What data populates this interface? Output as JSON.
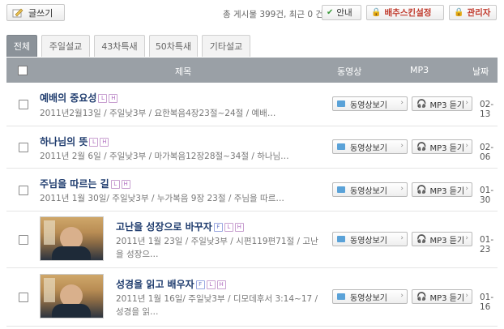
{
  "toolbar": {
    "write_label": "글쓰기",
    "count_text": "총 게시물 399건, 최근 0 건",
    "guide_label": "안내",
    "skin_label": "배추스킨설정",
    "admin_label": "관리자"
  },
  "tabs": [
    {
      "label": "전체",
      "active": true
    },
    {
      "label": "주일설교",
      "active": false
    },
    {
      "label": "43차특새",
      "active": false
    },
    {
      "label": "50차특새",
      "active": false
    },
    {
      "label": "기타설교",
      "active": false
    }
  ],
  "columns": {
    "title": "제목",
    "video": "동영상",
    "mp3": "MP3",
    "date": "날짜"
  },
  "buttons": {
    "video_label": "동영상보기",
    "mp3_label": "MP3 듣기"
  },
  "rows": [
    {
      "title": "예배의 중요성",
      "badges": [
        "L",
        "H"
      ],
      "meta": "2011년2월13일 / 주일낮3부 / 요한복음4장23절~24절 / 예배…",
      "date": "02-13"
    },
    {
      "title": "하나님의 뜻",
      "badges": [
        "L",
        "H"
      ],
      "meta": "2011년 2월 6일 / 주일낮3부 / 마가복음12장28절~34절 / 하나님…",
      "date": "02-06"
    },
    {
      "title": "주님을 따르는 길",
      "badges": [
        "L",
        "H"
      ],
      "meta": "2011년 1월 30일/ 주일낮3부 / 누가복음 9장 23절 / 주님을 따르…",
      "date": "01-30"
    },
    {
      "title": "고난을 성장으로 바꾸자",
      "badges": [
        "F",
        "L",
        "H"
      ],
      "meta_line1": "2011년 1월 23일 / 주일낮3부 / 시편119편71절 / 고난",
      "meta_line2": "을 성장으…",
      "date": "01-23"
    },
    {
      "title": "성경을 읽고 배우자",
      "badges": [
        "F",
        "L",
        "H"
      ],
      "meta_line1": "2011년 1월 16일/ 주일낮3부 / 디모데후서 3:14~17 /",
      "meta_line2": "성경을 읽…",
      "date": "01-16"
    }
  ]
}
